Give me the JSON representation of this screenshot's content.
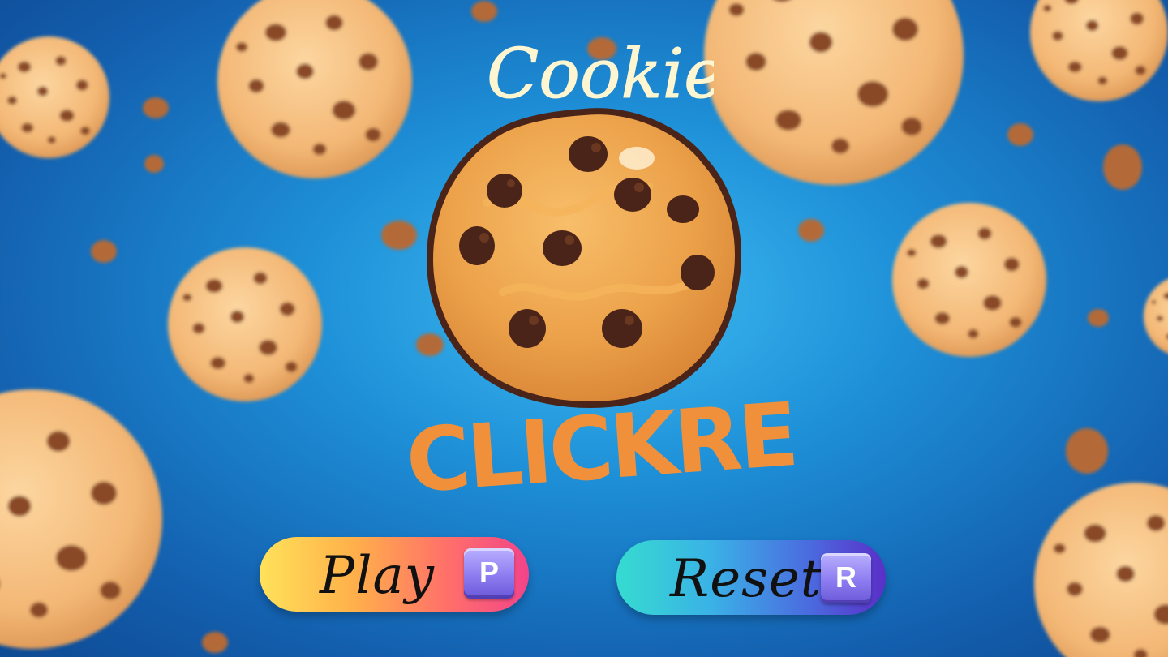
{
  "title": {
    "top": "Cookie",
    "bottom": "CLICKRE"
  },
  "buttons": {
    "play": {
      "label": "Play",
      "key": "P"
    },
    "reset": {
      "label": "Reset",
      "key": "R"
    }
  },
  "colors": {
    "background": "#1e90d8",
    "title_top": "#fdf6d0",
    "title_bottom": "#f0903a",
    "cookie": "#e59a3e",
    "chip": "#4a2418"
  }
}
